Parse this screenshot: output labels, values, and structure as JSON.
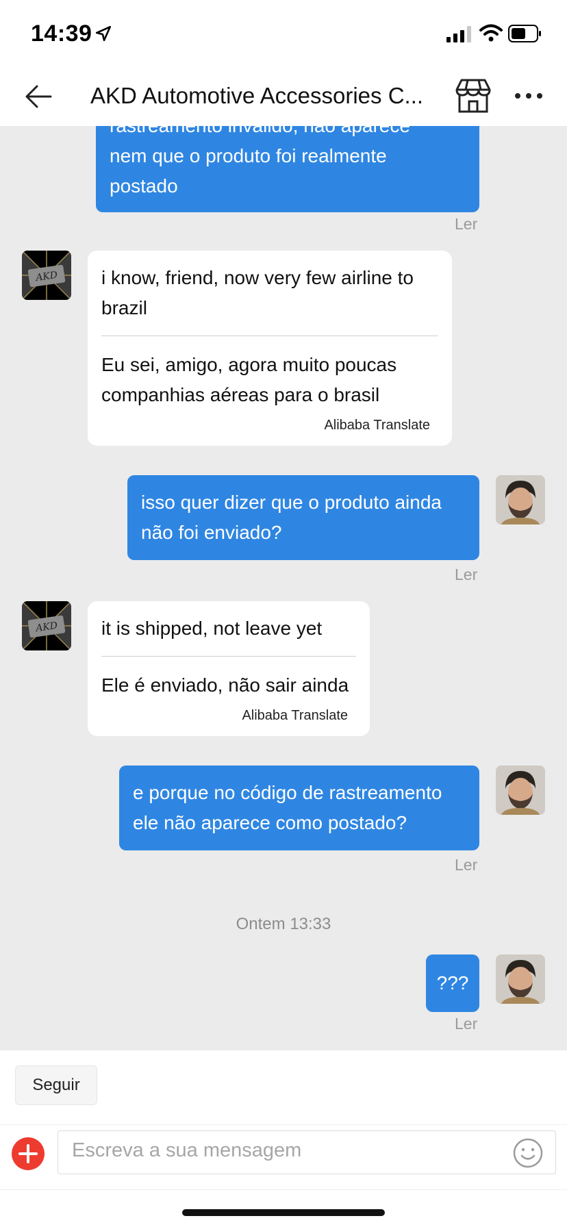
{
  "status_bar": {
    "time": "14:39"
  },
  "header": {
    "title": "AKD Automotive Accessories C..."
  },
  "messages": [
    {
      "dir": "out",
      "lines": [
        "rastreamento inválido, não aparece",
        "nem que o produto foi realmente",
        "postado"
      ],
      "status": "Ler"
    },
    {
      "dir": "in",
      "original": "i know, friend, now very few airline to brazil",
      "translated": "Eu sei, amigo, agora muito poucas companhias aéreas para o brasil",
      "translate_label": "Alibaba Translate"
    },
    {
      "dir": "out",
      "text": "isso quer dizer que o produto ainda não foi enviado?",
      "status": "Ler"
    },
    {
      "dir": "in",
      "original": "it is shipped, not leave yet",
      "translated": "Ele é enviado, não sair ainda",
      "translate_label": "Alibaba Translate"
    },
    {
      "dir": "out",
      "text": "e porque no código de rastreamento ele não aparece como postado?",
      "status": "Ler"
    },
    {
      "dir": "out",
      "text": "???",
      "status": "Ler"
    }
  ],
  "date_separator": "Ontem 13:33",
  "bottom": {
    "follow_label": "Seguir",
    "input_placeholder": "Escreva a sua mensagem"
  },
  "colors": {
    "outgoing_bubble": "#2f86e2",
    "chat_background": "#ebebeb",
    "plus_button": "#ee3b2f"
  }
}
